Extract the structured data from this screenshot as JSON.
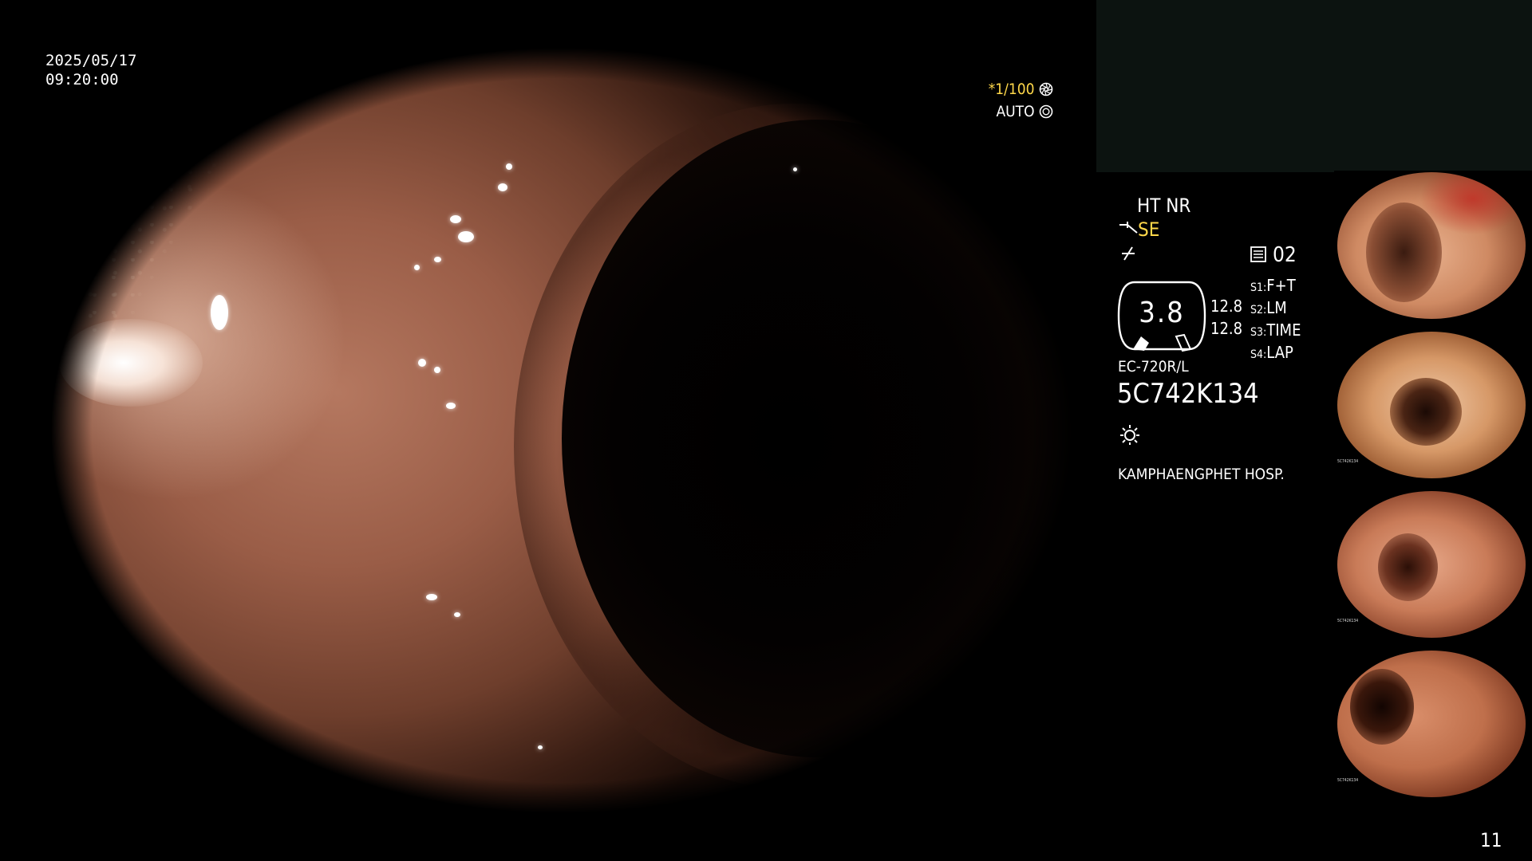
{
  "datetime": {
    "date": "2025/05/17",
    "time": "09:20:00"
  },
  "shutter": {
    "value": "*1/100",
    "mode": "AUTO"
  },
  "settings": {
    "ht_nr": "HT NR",
    "enhance": "SE",
    "storage": "02",
    "gauge_value": "3.8",
    "gauge_left_values": [
      "12.8",
      "12.8"
    ],
    "switches": [
      {
        "key": "S1",
        "value": "F+T"
      },
      {
        "key": "S2",
        "value": "LM"
      },
      {
        "key": "S3",
        "value": "TIME"
      },
      {
        "key": "S4",
        "value": "LAP"
      }
    ]
  },
  "scope": {
    "model": "EC-720R/L",
    "serial": "5C742K134"
  },
  "hospital": "KAMPHAENGPHET HOSP.",
  "page_number": "11",
  "thumbnail_serial": "5C742K134",
  "icons": [
    "shutter-icon",
    "iris-icon",
    "enhance-icon",
    "freeze-icon",
    "storage-icon",
    "light-icon"
  ],
  "colors": {
    "overlay_text": "#ffffff",
    "highlight": "#ffd84a",
    "info_box": "#0c1310"
  }
}
